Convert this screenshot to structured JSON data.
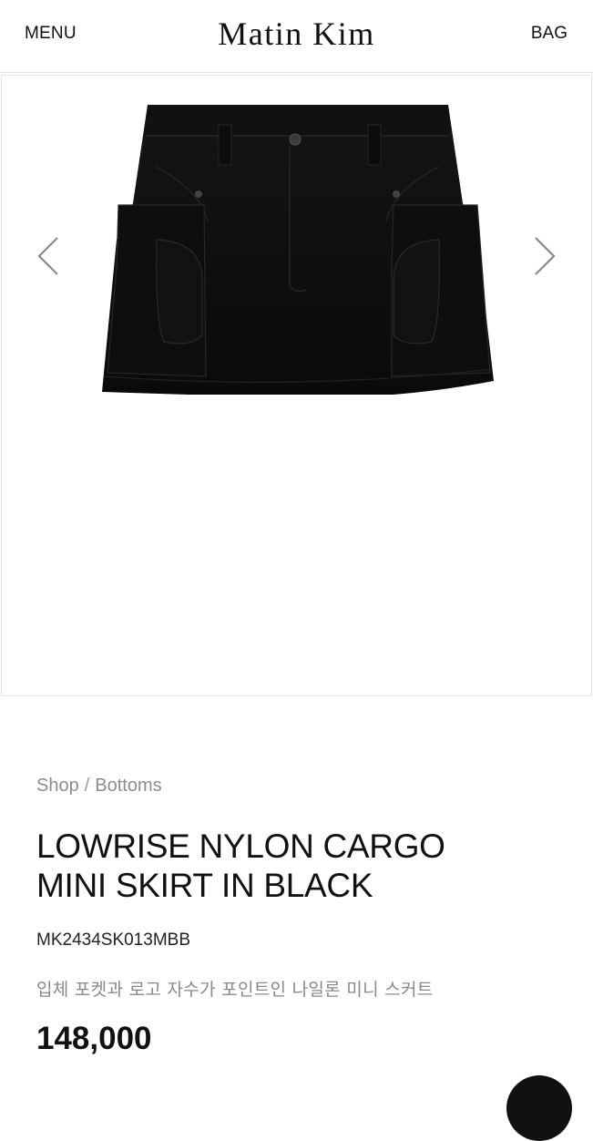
{
  "header": {
    "menu_label": "MENU",
    "brand": "Matin Kim",
    "bag_label": "BAG"
  },
  "gallery": {
    "prev_icon": "chevron-left-icon",
    "next_icon": "chevron-right-icon",
    "image_alt": "black nylon cargo mini skirt"
  },
  "breadcrumb": {
    "items": [
      "Shop",
      "Bottoms"
    ],
    "separator": "/"
  },
  "product": {
    "title_line1": "LOWRISE NYLON CARGO",
    "title_line2": "MINI SKIRT IN BLACK",
    "sku": "MK2434SK013MBB",
    "description": "입체 포켓과 로고 자수가 포인트인 나일론 미니 스커트",
    "price": "148,000"
  },
  "colors": {
    "text": "#111111",
    "muted": "#8d8d8d",
    "border": "#e2e2e2",
    "skirt": "#0d0d0d"
  }
}
